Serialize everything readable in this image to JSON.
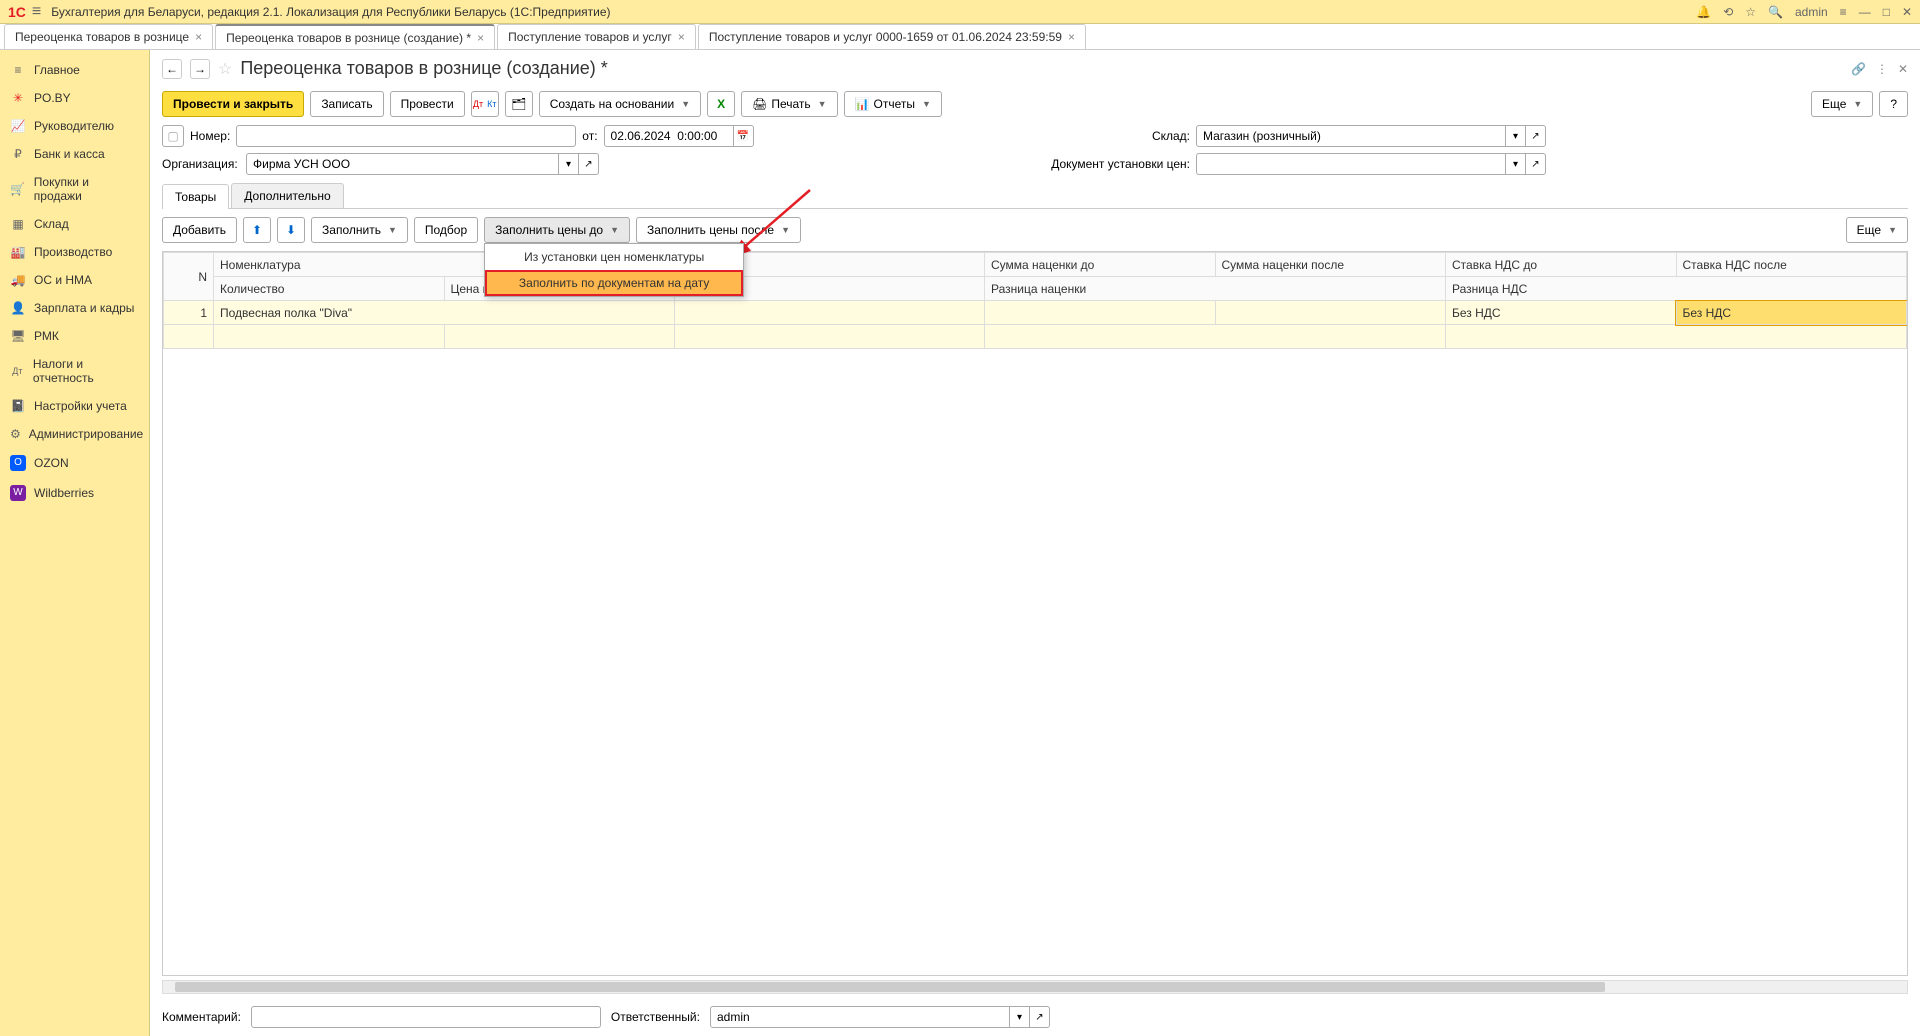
{
  "app": {
    "title": "Бухгалтерия для Беларуси, редакция 2.1. Локализация для Республики Беларусь  (1С:Предприятие)",
    "user": "admin"
  },
  "tabs": [
    {
      "label": "Переоценка товаров в рознице"
    },
    {
      "label": "Переоценка товаров в рознице (создание) *"
    },
    {
      "label": "Поступление товаров и услуг"
    },
    {
      "label": "Поступление товаров и услуг 0000-1659 от 01.06.2024 23:59:59"
    }
  ],
  "sidebar": {
    "items": [
      {
        "icon": "≡",
        "label": "Главное"
      },
      {
        "icon": "✳",
        "label": "PO.BY"
      },
      {
        "icon": "📈",
        "label": "Руководителю"
      },
      {
        "icon": "₽",
        "label": "Банк и касса"
      },
      {
        "icon": "🛒",
        "label": "Покупки и продажи"
      },
      {
        "icon": "▦",
        "label": "Склад"
      },
      {
        "icon": "🏭",
        "label": "Производство"
      },
      {
        "icon": "🚚",
        "label": "ОС и НМА"
      },
      {
        "icon": "👤",
        "label": "Зарплата и кадры"
      },
      {
        "icon": "🖥",
        "label": "РМК"
      },
      {
        "icon": "Дт",
        "label": "Налоги и отчетность"
      },
      {
        "icon": "📓",
        "label": "Настройки учета"
      },
      {
        "icon": "⚙",
        "label": "Администрирование"
      },
      {
        "icon": "O",
        "label": "OZON"
      },
      {
        "icon": "W",
        "label": "Wildberries"
      }
    ]
  },
  "page": {
    "title": "Переоценка товаров в рознице (создание) *"
  },
  "toolbar": {
    "post_close": "Провести и закрыть",
    "save": "Записать",
    "post": "Провести",
    "create_based": "Создать на основании",
    "print": "Печать",
    "reports": "Отчеты",
    "more": "Еще",
    "help": "?"
  },
  "form": {
    "number_label": "Номер:",
    "number_value": "",
    "from_label": "от:",
    "from_value": "02.06.2024  0:00:00",
    "warehouse_label": "Склад:",
    "warehouse_value": "Магазин (розничный)",
    "org_label": "Организация:",
    "org_value": "Фирма УСН ООО",
    "pricedoc_label": "Документ установки цен:",
    "pricedoc_value": ""
  },
  "tabset": {
    "goods": "Товары",
    "extra": "Дополнительно"
  },
  "table_toolbar": {
    "add": "Добавить",
    "fill": "Заполнить",
    "pick": "Подбор",
    "fill_before": "Заполнить цены до",
    "fill_after": "Заполнить цены после",
    "more": "Еще"
  },
  "dropdown": {
    "item1": "Из установки цен номенклатуры",
    "item2": "Заполнить по документам на дату"
  },
  "table": {
    "headers": {
      "n": "N",
      "nomen": "Номенклатура",
      "qty": "Количество",
      "price_in": "Цена поступления",
      "markup_before": "Сумма наценки до",
      "markup_after": "Сумма наценки после",
      "markup_diff": "Разница наценки",
      "vat_before": "Ставка НДС до",
      "vat_after": "Ставка НДС после",
      "vat_diff": "Разница НДС"
    },
    "rows": [
      {
        "n": "1",
        "nomen": "Подвесная полка \"Diva\"",
        "vat_before": "Без НДС",
        "vat_after": "Без НДС"
      }
    ]
  },
  "footer": {
    "comment_label": "Комментарий:",
    "comment_value": "",
    "resp_label": "Ответственный:",
    "resp_value": "admin"
  }
}
